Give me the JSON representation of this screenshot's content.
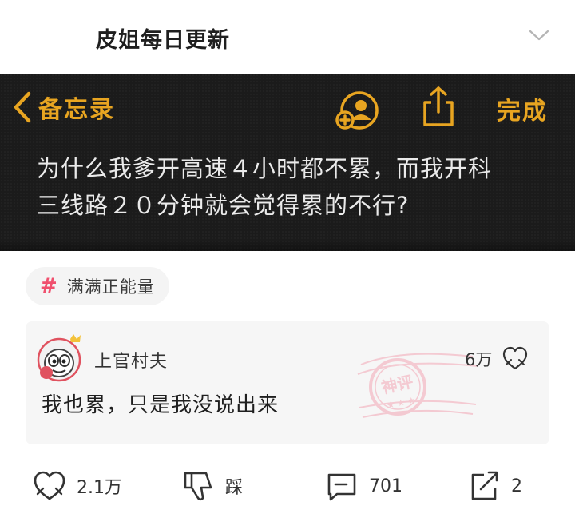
{
  "header": {
    "title": "皮姐每日更新",
    "chevron_icon": "chevron-down-icon"
  },
  "memo": {
    "back_label": "备忘录",
    "done_label": "完成",
    "icons": [
      "chevron-left-icon",
      "add-person-icon",
      "share-icon"
    ],
    "accent_color": "#e8a521",
    "text_lines": [
      "为什么我爹开高速４小时都不累，而我开科",
      "三线路２０分钟就会觉得累的不行?"
    ]
  },
  "topic": {
    "symbol": "#",
    "label": "满满正能量",
    "accent_color": "#f0506e"
  },
  "comment": {
    "username": "上官村夫",
    "likes": "6万",
    "text": "我也累，只是我没说出来",
    "stamp_label": "神评",
    "stamp_color": "#f2a6b4"
  },
  "actions": {
    "like_count": "2.1万",
    "dislike_label": "踩",
    "comment_count": "701",
    "share_count": "2"
  }
}
